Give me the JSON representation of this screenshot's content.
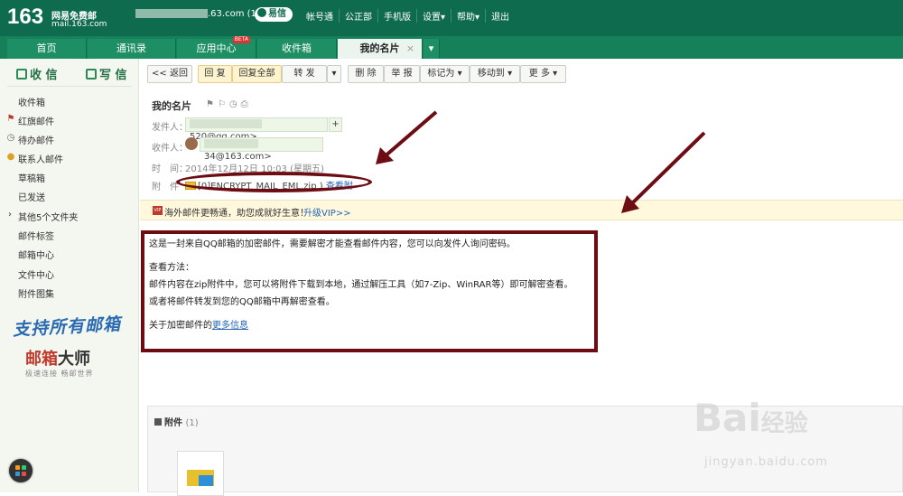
{
  "brand": {
    "logo_number": "163",
    "logo_name": "网易免费邮",
    "logo_domain": "mail.163.com"
  },
  "top": {
    "user_suffix": ".63.com (1) ∨",
    "yixin": "易信",
    "links": [
      "帐号通",
      "公正部",
      "手机版",
      "设置▾",
      "帮助▾",
      "退出"
    ]
  },
  "nav": {
    "tabs": [
      "首页",
      "通讯录",
      "应用中心",
      "收件箱",
      "我的名片"
    ],
    "beta": "BETA",
    "close": "×"
  },
  "sidebar": {
    "receive": "收 信",
    "compose": "写 信",
    "folders": [
      "收件箱",
      "红旗邮件",
      "待办邮件",
      "联系人邮件",
      "草稿箱",
      "已发送",
      "其他5个文件夹",
      "邮件标签",
      "邮箱中心",
      "文件中心",
      "附件图集"
    ],
    "promo_slogan": "支持所有邮箱",
    "promo_red": "邮箱",
    "promo_dark": "大师",
    "promo_sub": "极速连接 畅邮世界"
  },
  "toolbar": {
    "back": "<< 返回",
    "reply": "回 复",
    "reply_all": "回复全部",
    "forward": "转 发",
    "delete": "删 除",
    "report": "举 报",
    "mark_as": "标记为 ▾",
    "move_to": "移动到 ▾",
    "more": "更 多 ▾"
  },
  "mail": {
    "title": "我的名片",
    "title_icons": "⚑⚐◷⎙",
    "sender_label": "发件人：",
    "sender_email": "520@qq.com>",
    "recipient_label": "收件人：",
    "recipient_email": "34@163.com>",
    "time_label": "时　间：",
    "time_value": "2014年12月12日 10:03 (星期五)",
    "attach_label": "附　件",
    "attach_file": "[0]ENCRYPT_MAIL_EML.zip )",
    "attach_view": "查看附",
    "add_contact": "+"
  },
  "vip": {
    "badge": "VIP",
    "text": "海外邮件更畅通，助您成就好生意！",
    "link": "升级VIP>>"
  },
  "body": {
    "line1": "这是一封来自QQ邮箱的加密邮件，需要解密才能查看邮件内容，您可以向发件人询问密码。",
    "line2": "查看方法：",
    "line3": "邮件内容在zip附件中，您可以将附件下载到本地，通过解压工具（如7-Zip、WinRAR等）即可解密查看。",
    "line4": "或者将邮件转发到您的QQ邮箱中再解密查看。",
    "line5_prefix": "关于加密邮件的",
    "line5_link": "更多信息"
  },
  "attachments": {
    "heading": "附件",
    "count": "(1)"
  },
  "watermark": {
    "main": "Bai",
    "mid": "经验",
    "sub": "jingyan.baidu.com"
  }
}
